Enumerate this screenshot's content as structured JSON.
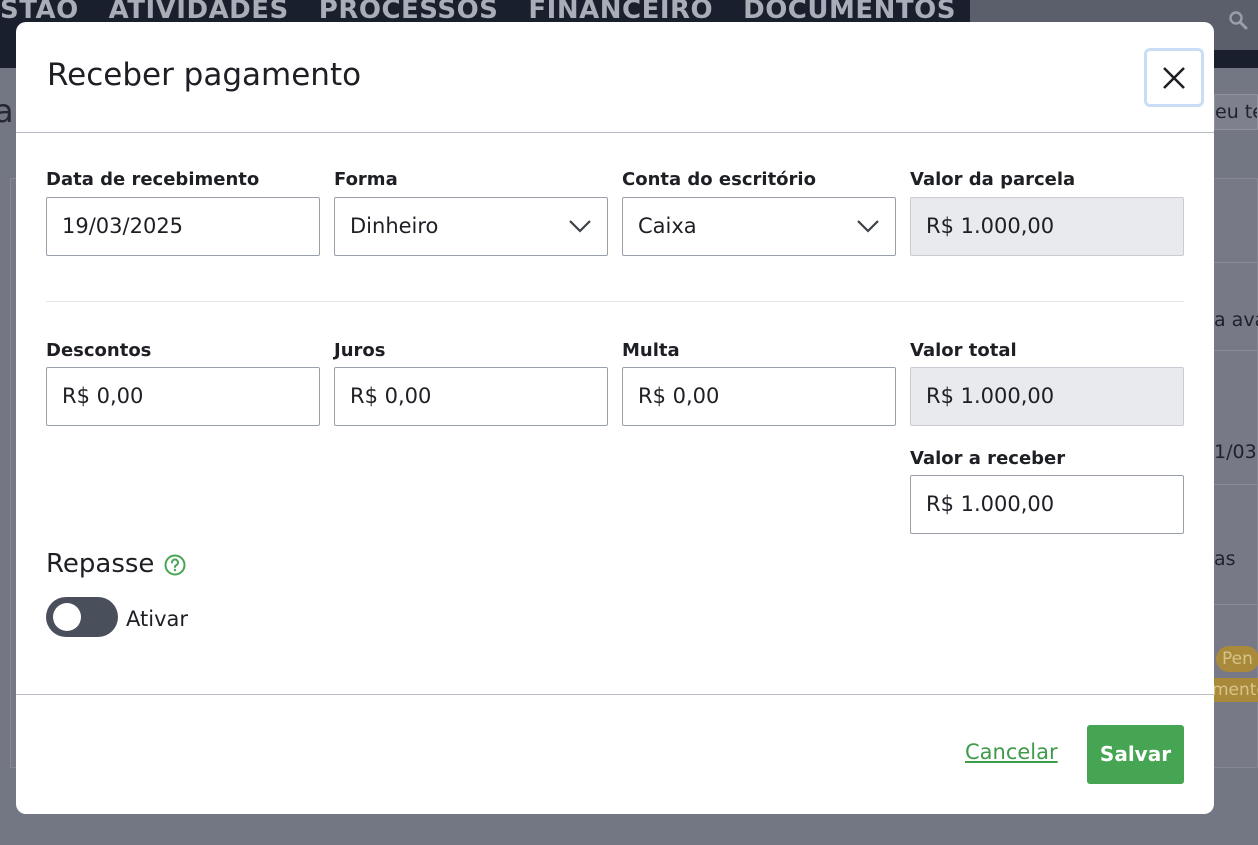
{
  "background": {
    "nav_items": [
      "STÃO",
      "ATIVIDADES",
      "PROCESSOS",
      "FINANCEIRO",
      "DOCUMENTOS"
    ],
    "left_fragment": "a",
    "right_fragments": {
      "top_box": "eu te",
      "row1": "a ava",
      "row2": "1/03",
      "row3": "as",
      "pill1": "Pen",
      "pill2": "mente"
    }
  },
  "modal": {
    "title": "Receber pagamento",
    "fields_row1": [
      {
        "label": "Data de recebimento",
        "value": "19/03/2025"
      },
      {
        "label": "Forma",
        "value": "Dinheiro"
      },
      {
        "label": "Conta do escritório",
        "value": "Caixa"
      },
      {
        "label": "Valor da parcela",
        "value": "R$ 1.000,00"
      }
    ],
    "fields_row2": [
      {
        "label": "Descontos",
        "value": "R$ 0,00"
      },
      {
        "label": "Juros",
        "value": "R$ 0,00"
      },
      {
        "label": "Multa",
        "value": "R$ 0,00"
      },
      {
        "label": "Valor total",
        "value": "R$ 1.000,00"
      }
    ],
    "valor_receber": {
      "label": "Valor a receber",
      "value": "R$ 1.000,00"
    },
    "repasse": {
      "title": "Repasse",
      "toggle_label": "Ativar",
      "enabled": false
    },
    "footer": {
      "cancel_label": "Cancelar",
      "save_label": "Salvar"
    },
    "colors": {
      "accent": "#46a552",
      "link": "#3f9b4a",
      "toggle_off": "#4a4f5c",
      "readonly_bg": "#e8eaed"
    }
  }
}
